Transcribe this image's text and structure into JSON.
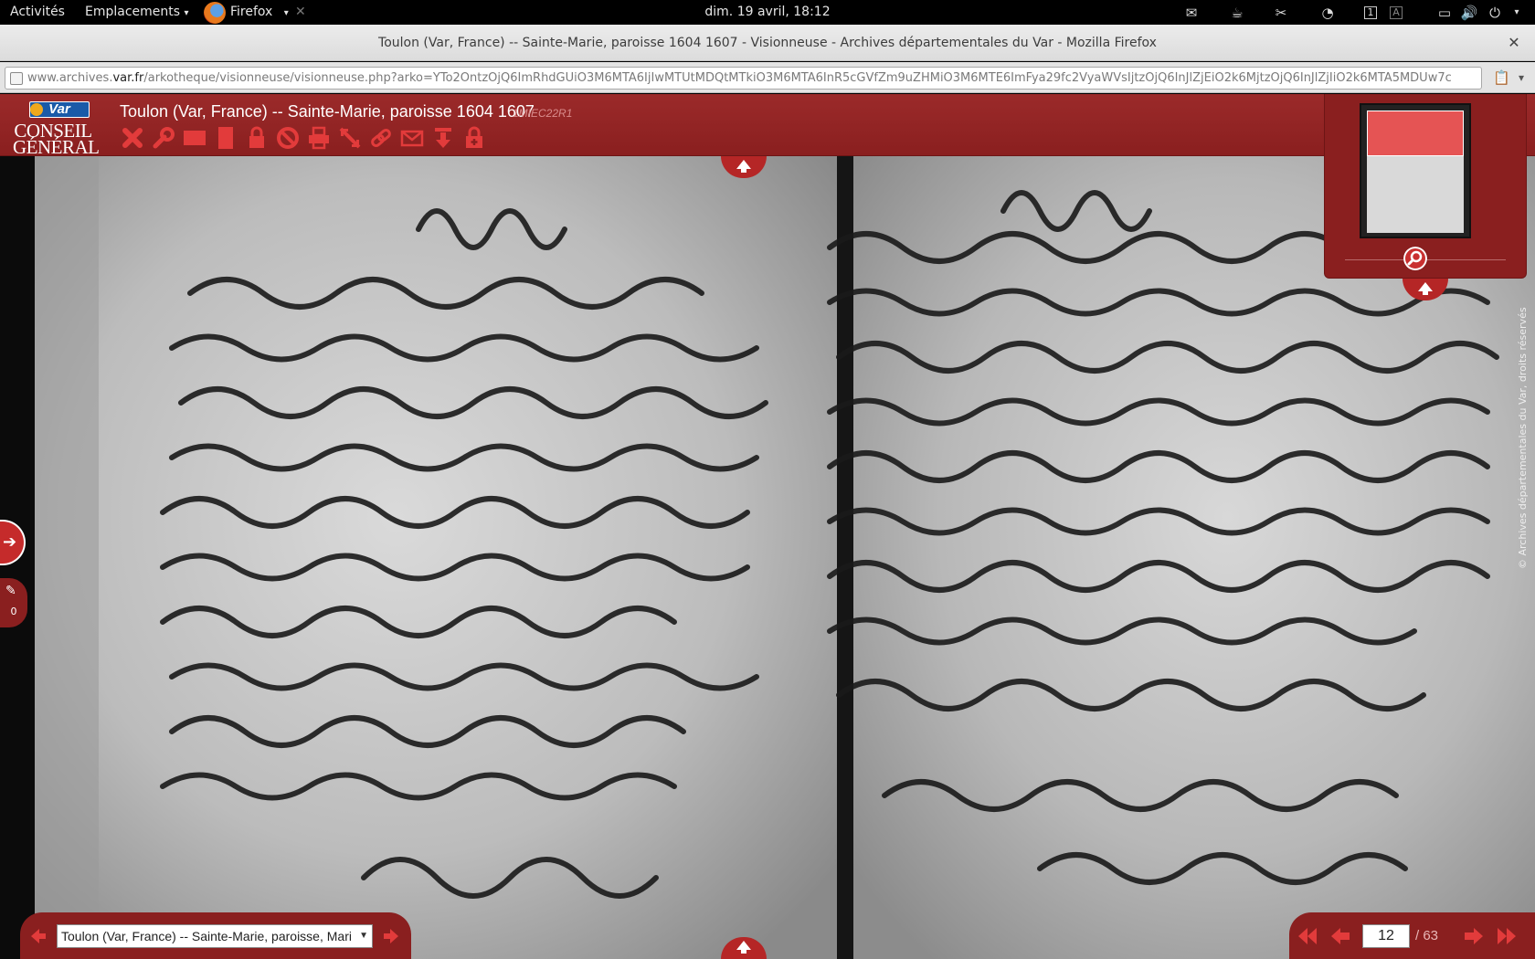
{
  "topbar": {
    "activities": "Activités",
    "places": "Emplacements",
    "places_chevron": "▾",
    "app": "Firefox",
    "app_chevron": "▾",
    "clock": "dim. 19 avril, 18:12",
    "icons": [
      "mail-icon",
      "coffee-icon",
      "scissors-icon",
      "clock-icon",
      "workspace-1-icon",
      "keyboard-a-icon",
      "window-icon",
      "volume-icon",
      "power-icon"
    ],
    "workspace": "1",
    "keyboard": "A"
  },
  "window": {
    "title": "Toulon (Var, France) -- Sainte-Marie, paroisse 1604 1607 - Visionneuse - Archives départementales du Var - Mozilla Firefox",
    "close": "✕"
  },
  "urlbar": {
    "url_prefix": "www.archives.",
    "url_domain": "var.fr",
    "url_path": "/arkotheque/visionneuse/visionneuse.php?arko=YTo2OntzOjQ6ImRhdGUiO3M6MTA6IjIwMTUtMDQtMTkiO3M6MTA6InR5cGVfZm9uZHMiO3M6MTE6ImFya29fc2VyaWVsIjtzOjQ6InJlZjEiO2k6MjtzOjQ6InJlZjIiO2k6MTA5MDUw7c"
  },
  "viewer": {
    "logo_badge": "Var",
    "logo_line1": "CONSEIL",
    "logo_line2": "GÉNÉRAL",
    "title": "Toulon (Var, France) -- Sainte-Marie, paroisse 1604 1607",
    "cote": "1MIEC22R1",
    "toolbar": [
      "close-icon",
      "wrench-icon",
      "rectangle-horizontal-icon",
      "rectangle-vertical-icon",
      "lock-icon",
      "forbidden-icon",
      "print-icon",
      "resize-icon",
      "link-icon",
      "mail-icon",
      "download-icon",
      "lock-plus-icon"
    ],
    "copyright": "© Archives départementales du Var, droits réservés",
    "annotation_count": "0",
    "volume_select": "Toulon (Var, France) -- Sainte-Marie, paroisse, Mari",
    "page_current": "12",
    "page_total": "/ 63",
    "thumbnail_view_fraction": 0.37
  },
  "colors": {
    "header_red": "#8a1f1f",
    "accent_red": "#c52b2b",
    "icon_red": "#e23b3b"
  }
}
